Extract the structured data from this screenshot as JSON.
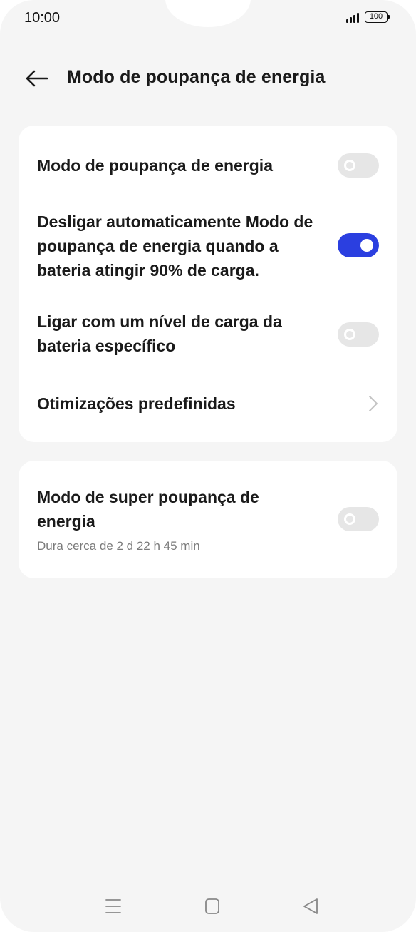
{
  "status_bar": {
    "time": "10:00",
    "battery_level": "100",
    "icons": [
      "signal-icon",
      "battery-icon"
    ]
  },
  "header": {
    "title": "Modo de poupança de energia",
    "back_icon": "arrow-left-icon"
  },
  "settings": {
    "power_saving_mode": {
      "label": "Modo de poupança de energia",
      "enabled": false
    },
    "auto_disable": {
      "label": "Desligar automaticamente Modo de poupança de energia quando a bateria atingir 90% de carga.",
      "enabled": true
    },
    "battery_level_trigger": {
      "label": "Ligar com um nível de carga da bateria específico",
      "enabled": false
    },
    "preset_optimizations": {
      "label": "Otimizações predefinidas",
      "icon": "chevron-right-icon"
    },
    "super_power_saving": {
      "label": "Modo de super poupança de energia",
      "sublabel": "Dura cerca de 2 d 22 h 45 min",
      "enabled": false
    }
  },
  "navigation": {
    "icons": [
      "menu-icon",
      "home-icon",
      "back-icon"
    ]
  },
  "colors": {
    "accent": "#2b3fe0",
    "background": "#f5f5f5",
    "card": "#ffffff",
    "toggle_off": "#e6e6e6"
  }
}
